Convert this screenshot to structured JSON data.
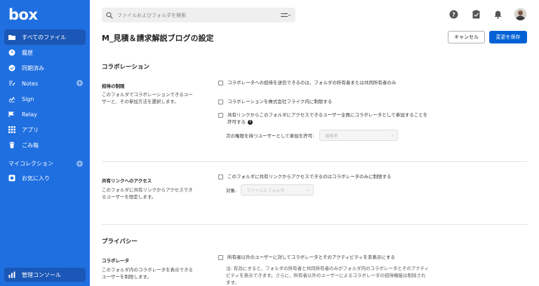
{
  "app": {
    "logo": "box"
  },
  "sidebar": {
    "items": [
      {
        "label": "すべてのファイル",
        "icon": "folder-icon",
        "active": true
      },
      {
        "label": "履歴",
        "icon": "clock-icon"
      },
      {
        "label": "同期済み",
        "icon": "check-circle-icon"
      },
      {
        "label": "Notes",
        "icon": "notes-icon",
        "plus": true
      },
      {
        "label": "Sign",
        "icon": "sign-icon"
      },
      {
        "label": "Relay",
        "icon": "relay-icon"
      },
      {
        "label": "アプリ",
        "icon": "grid-icon"
      },
      {
        "label": "ごみ箱",
        "icon": "trash-icon"
      }
    ],
    "collection_label": "マイコレクション",
    "favorites_label": "お気に入り",
    "admin_label": "管理コンソール"
  },
  "search": {
    "placeholder": "ファイルおよびフォルダを検索"
  },
  "header": {
    "title": "M_見積＆請求解説ブログの設定",
    "cancel_label": "キャンセル",
    "save_label": "変更を保存"
  },
  "collaboration": {
    "section_title": "コラボレーション",
    "invite_title": "招待の制限",
    "invite_desc": "このフォルダでコラボレーションできるユーザーと、その参加方法を選択します。",
    "opt1": "コラボレータへの招待を送信できるのは、フォルダの所有者または共同所有者のみ",
    "opt2": "コラボレーションを株式会社フライク内に制限する",
    "opt3": "共有リンクからこのフォルダにアクセスできるユーザー全員にコラボレータとして参加することを許可する",
    "permission_label": "次の権限を持つユーザーとして参加を許可:",
    "permission_value": "編集者"
  },
  "shared_link": {
    "title": "共有リンクへのアクセス",
    "desc": "このフォルダに共有リンクからアクセスできるユーザーを限定します。",
    "opt1": "このフォルダに共有リンクからアクセスできるのはコラボレータのみに制限する",
    "target_label": "対象:",
    "target_value": "ファイルとフォルダ"
  },
  "privacy": {
    "section_title": "プライバシー",
    "collab_title": "コラボレータ",
    "collab_desc": "このフォルダ内のコラボレータを表示できるユーザーを制限します。",
    "opt1": "所有者以外のユーザーに対してコラボレータとそのアクティビティを非表示にする",
    "note": "注: 有効にすると、フォルダの所有者と共同所有者のみがフォルダ内のコラボレータとそのアクティビティを表示できます。さらに、所有者以外のユーザーによるコラボレータの招待機能は削除されます。"
  },
  "colors": {
    "sidebar": "#1f6fe0",
    "primary_button": "#0061d5"
  }
}
